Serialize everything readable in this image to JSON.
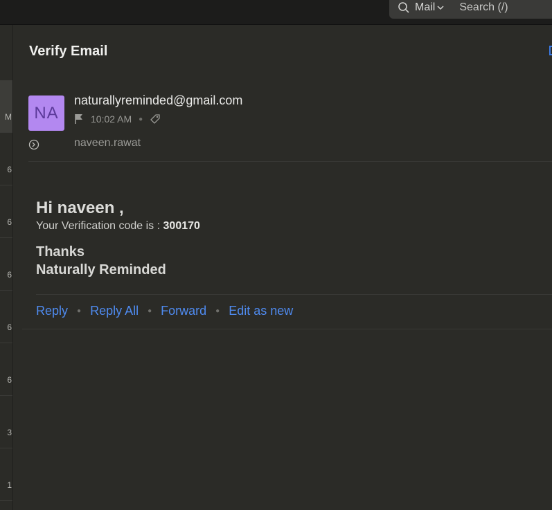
{
  "header": {
    "search_scope": "Mail",
    "search_placeholder": "Search (/)"
  },
  "message_list": {
    "visible_time_fragments": [
      "M",
      "6",
      "6",
      "6",
      "6",
      "6",
      "3",
      "1"
    ]
  },
  "message": {
    "subject": "Verify Email",
    "avatar_initials": "NA",
    "avatar_color": "#b388f0",
    "sender": "naturallyreminded@gmail.com",
    "time": "10:02 AM",
    "recipient": "naveen.rawat"
  },
  "body": {
    "greeting": "Hi naveen ,",
    "code_prefix": "Your Verification code is : ",
    "code": "300170",
    "thanks": "Thanks",
    "signature": "Naturally Reminded"
  },
  "actions": {
    "reply": "Reply",
    "reply_all": "Reply All",
    "forward": "Forward",
    "edit_as_new": "Edit as new"
  },
  "colors": {
    "background": "#2b2b27",
    "accent": "#4f8bf0"
  }
}
